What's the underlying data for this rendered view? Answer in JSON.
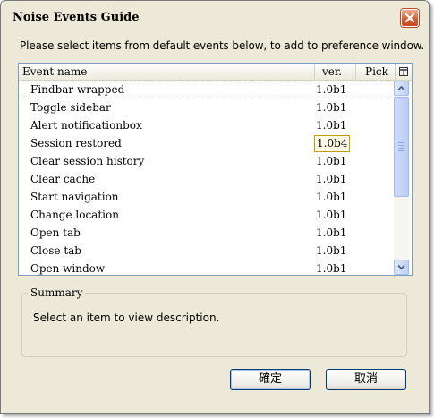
{
  "window": {
    "title": "Noise Events Guide"
  },
  "instruction": "Please select items from default events below, to add to preference window.",
  "tree": {
    "columns": {
      "name": "Event name",
      "ver": "ver.",
      "pick": "Pick"
    },
    "rows": [
      {
        "name": "Findbar wrapped",
        "ver": "1.0b1"
      },
      {
        "name": "Toggle sidebar",
        "ver": "1.0b1"
      },
      {
        "name": "Alert notificationbox",
        "ver": "1.0b1"
      },
      {
        "name": "Session restored",
        "ver": "1.0b4"
      },
      {
        "name": "Clear session history",
        "ver": "1.0b1"
      },
      {
        "name": "Clear cache",
        "ver": "1.0b1"
      },
      {
        "name": "Start navigation",
        "ver": "1.0b1"
      },
      {
        "name": "Change location",
        "ver": "1.0b1"
      },
      {
        "name": "Open tab",
        "ver": "1.0b1"
      },
      {
        "name": "Close tab",
        "ver": "1.0b1"
      },
      {
        "name": "Open window",
        "ver": "1.0b1"
      }
    ]
  },
  "summary": {
    "legend": "Summary",
    "text": "Select an item to view description."
  },
  "buttons": {
    "ok": "確定",
    "cancel": "取消"
  }
}
